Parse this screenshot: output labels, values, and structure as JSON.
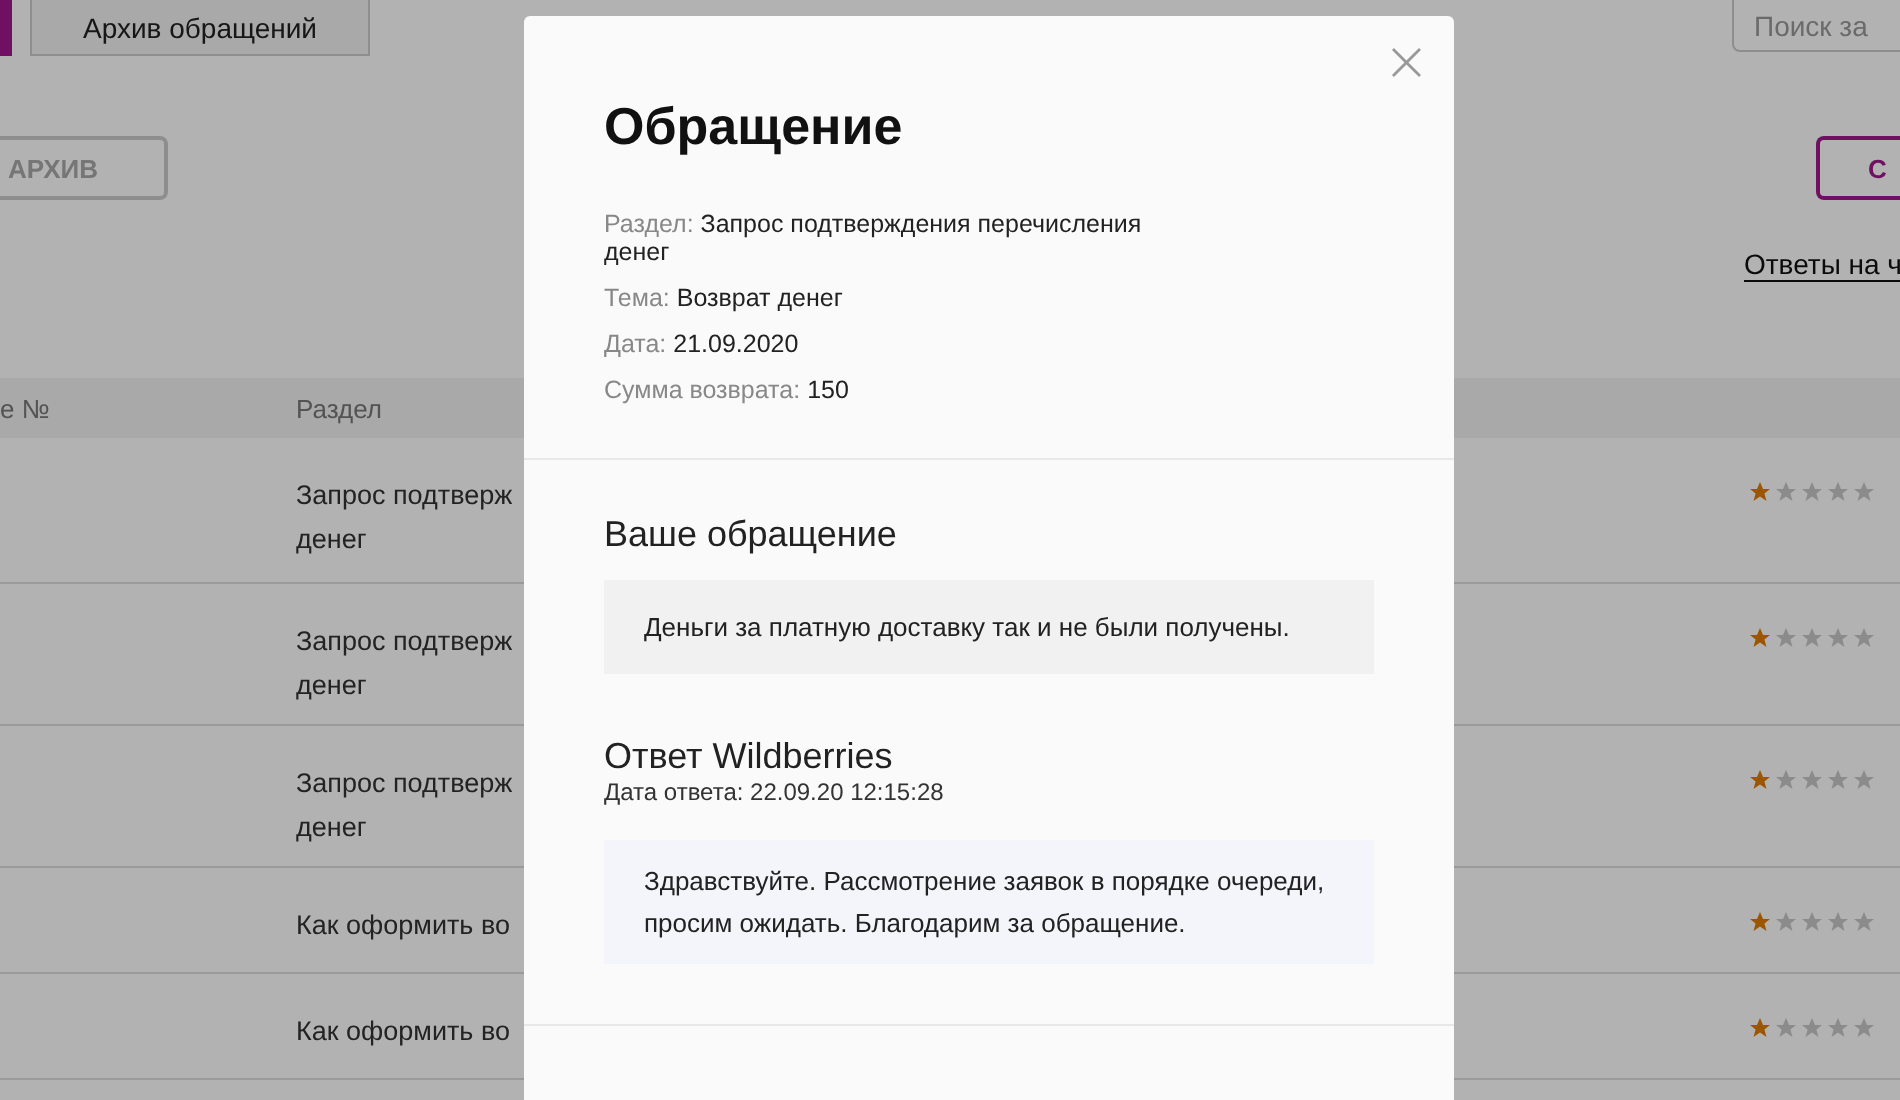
{
  "tabs": [
    {
      "label": "Архив обращений",
      "selected": false
    }
  ],
  "search": {
    "placeholder": "Поиск за"
  },
  "archive_button": "АРХИВ",
  "create_button": "С",
  "answers_link": "Ответы на ч",
  "table": {
    "columns": [
      "е №",
      "Раздел"
    ],
    "rows": [
      {
        "section": [
          "Запрос подтверж",
          "денег"
        ],
        "stars": 1
      },
      {
        "section": [
          "Запрос подтверж",
          "денег"
        ],
        "stars": 1
      },
      {
        "section": [
          "Запрос подтверж",
          "денег"
        ],
        "stars": 1
      },
      {
        "section": [
          "Как оформить во"
        ],
        "stars": 1
      },
      {
        "section": [
          "Как оформить во"
        ],
        "stars": 1
      }
    ]
  },
  "modal": {
    "title": "Обращение",
    "close": "×",
    "info": [
      {
        "label": "Раздел:",
        "value": "Запрос подтверждения перечисления денег"
      },
      {
        "label": "Тема:",
        "value": "Возврат денег"
      },
      {
        "label": "Дата:",
        "value": "21.09.2020"
      },
      {
        "label": "Сумма возврата:",
        "value": "150"
      }
    ],
    "request": {
      "heading": "Ваше обращение",
      "text": "Деньги за платную доставку так и не были получены."
    },
    "reply": {
      "heading": "Ответ Wildberries",
      "date": "Дата ответа: 22.09.20 12:15:28",
      "text": "Здравствуйте. Рассмотрение заявок в порядке очереди, просим ожидать. Благодарим за обращение."
    }
  }
}
